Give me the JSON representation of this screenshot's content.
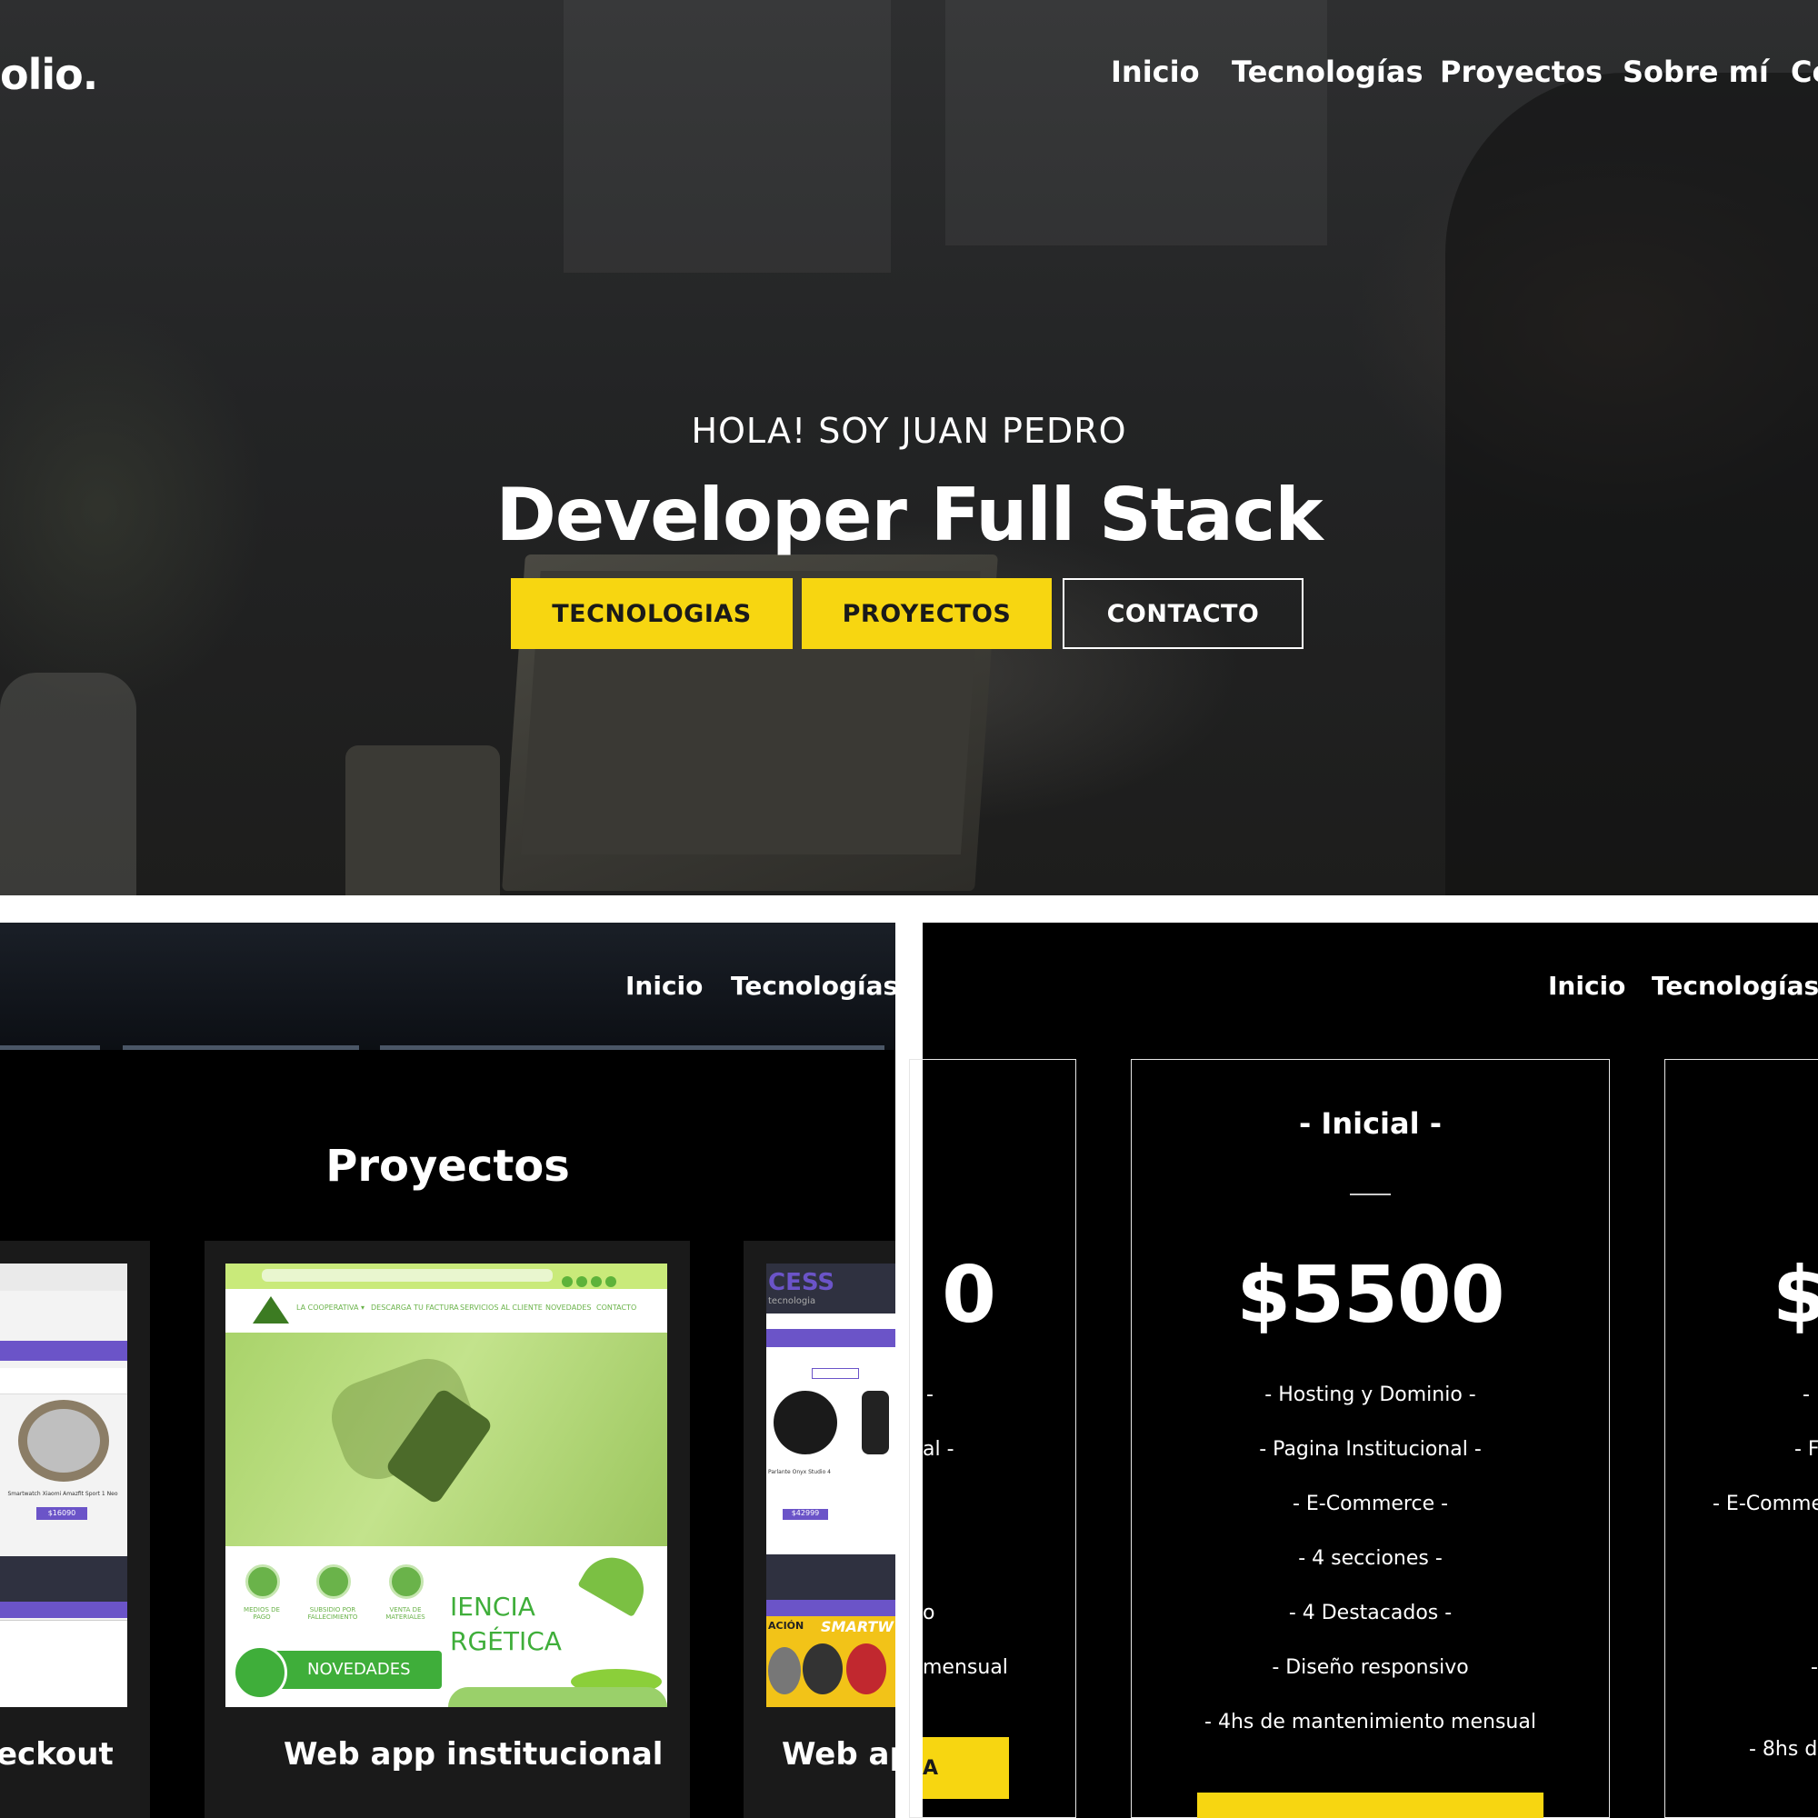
{
  "hero": {
    "logo": "olio.",
    "nav": [
      "Inicio",
      "Tecnologías",
      "Proyectos",
      "Sobre mí",
      "Co"
    ],
    "subtitle": "HOLA! SOY JUAN PEDRO",
    "title": "Developer Full Stack",
    "buttons": [
      "TECNOLOGIAS",
      "PROYECTOS",
      "CONTACTO"
    ]
  },
  "projects": {
    "nav": [
      "Inicio",
      "Tecnologías"
    ],
    "heading": "Proyectos",
    "cards": [
      {
        "name": "eckout"
      },
      {
        "name": "Web app institucional"
      },
      {
        "name": "Web ap"
      }
    ],
    "institucional_shot": {
      "menu": [
        "LA COOPERATIVA ▾",
        "DESCARGA TU FACTURA",
        "SERVICIOS AL CLIENTE",
        "NOVEDADES",
        "CONTACTO"
      ],
      "icons": [
        "MEDIOS DE PAGO",
        "SUBSIDIO POR FALLECIMIENTO",
        "VENTA DE MATERIALES"
      ],
      "novedades": "NOVEDADES",
      "energy_line1": "IENCIA",
      "energy_line2": "RGÉTICA"
    },
    "left_shot": {
      "product": "Smartwatch Xiaomi Amazfit Sport 1 Neo",
      "price": "$16090"
    },
    "right_shot": {
      "brand": "CESS",
      "sub": "tecnologia",
      "product": "Parlante Onyx Studio 4",
      "price": "$42999",
      "banner": "SMARTW",
      "promo": "ACIÓN"
    }
  },
  "pricing": {
    "nav": [
      "Inicio",
      "Tecnologías"
    ],
    "left": {
      "price": "0",
      "features": [
        "-",
        "al -",
        "o",
        "mensual"
      ],
      "button": "A"
    },
    "center": {
      "title": "- Inicial -",
      "price": "$5500",
      "features": [
        "- Hosting y Dominio -",
        "- Pagina Institucional -",
        "- E-Commerce -",
        "- 4 secciones -",
        "- 4 Destacados -",
        "- Diseño responsivo",
        "- 4hs de mantenimiento mensual"
      ]
    },
    "right": {
      "price": "$",
      "features": [
        "-",
        "- F",
        "- E-Comme",
        "-",
        "- 8hs de"
      ]
    }
  },
  "colors": {
    "accent": "#f7d611",
    "background": "#000000",
    "text": "#ffffff"
  }
}
